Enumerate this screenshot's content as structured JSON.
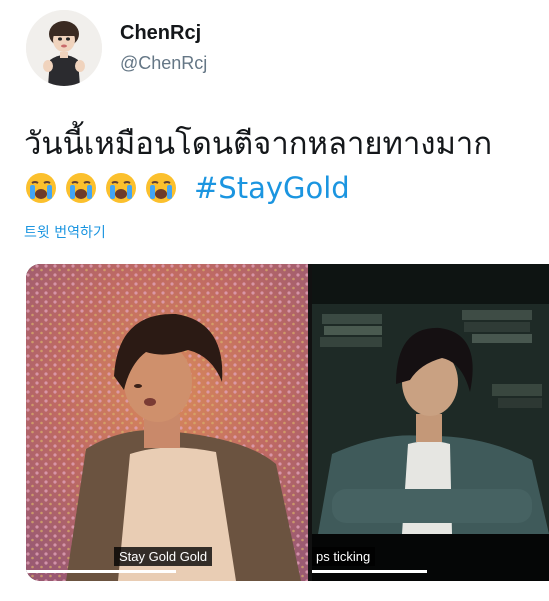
{
  "user": {
    "display_name": "ChenRcj",
    "handle": "@ChenRcj"
  },
  "tweet": {
    "text": "วันนี้เหมือนโดนตีจากหลายทางมาก",
    "emojis": [
      "loudly-crying-face-icon",
      "loudly-crying-face-icon",
      "loudly-crying-face-icon",
      "loudly-crying-face-icon"
    ],
    "hashtag": "#StayGold",
    "translate_label": "트윗 번역하기"
  },
  "media": {
    "left": {
      "caption": "Stay Gold Gold"
    },
    "right": {
      "caption": "ps ticking"
    }
  },
  "colors": {
    "link": "#1b95e0",
    "secondary_text": "#657786",
    "primary_text": "#14171a"
  }
}
